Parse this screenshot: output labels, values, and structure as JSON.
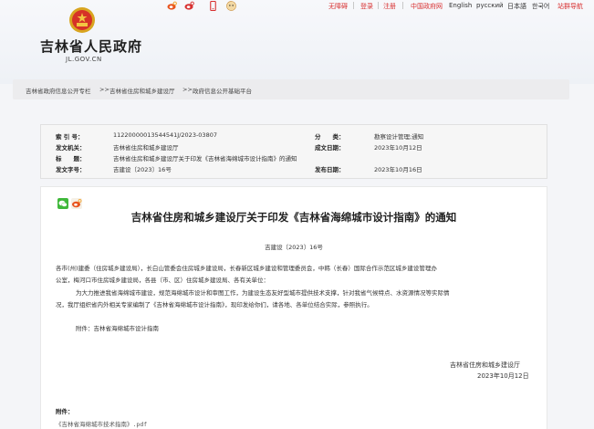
{
  "header": {
    "title": "吉林省人民政府",
    "domain": "JL.GOV.CN"
  },
  "topbar": {
    "icons": [
      "weibo-icon",
      "weibo-icon",
      "mobile-icon",
      "mascot-icon"
    ],
    "links": [
      "无障碍",
      "登录",
      "注册",
      "中国政府网",
      "English",
      "русский",
      "日本語",
      "한국어",
      "站群导航"
    ]
  },
  "breadcrumb": {
    "items": [
      "吉林省政府信息公开专栏",
      ">>",
      "吉林省住房和城乡建设厅",
      ">>",
      "政府信息公开基础平台"
    ]
  },
  "meta": {
    "index_label": "索 引 号：",
    "index_value": "11220000013544541J/2023-03807",
    "category_label": "分　　类：",
    "category_value": "勘察设计管理;通知",
    "issuer_label": "发文机关：",
    "issuer_value": "吉林省住房和城乡建设厅",
    "date_label": "成文日期：",
    "date_value": "2023年10月12日",
    "title_label": "标　　题：",
    "title_value": "吉林省住房和城乡建设厅关于印发《吉林省海绵城市设计指南》的通知",
    "docno_label": "发文字号：",
    "docno_value": "吉建设〔2023〕16号",
    "publish_label": "发布日期：",
    "publish_value": "2023年10月16日"
  },
  "article": {
    "title": "吉林省住房和城乡建设厅关于印发《吉林省海绵城市设计指南》的通知",
    "doc_number": "吉建设〔2023〕16号",
    "p1_line1": "各市(州)建委（住房城乡建设局），长白山管委会住房城乡建设局，长春新区城乡建设和管理委员会，中韩（长春）国际合作示范区城乡建设管理办",
    "p1_line2": "公室，梅河口市住房城乡建设局，各县（市、区）住房城乡建设局、各有关单位：",
    "p2_line1": "为大力推进我省海绵城市建设，规范海绵城市设计和审图工作，为建设生态友好型城市提供技术支撑，针对我省气候特点、水资源情况等实际情",
    "p2_line2": "况，我厅组织省内外相关专家编制了《吉林省海绵城市设计指南》，现印发给你们，请各地、各单位结合实际，参照执行。",
    "attachment_inline": "附件：吉林省海绵城市设计指南",
    "signature": "吉林省住房和城乡建设厅",
    "sign_date": "2023年10月12日",
    "attachments_label": "附件：",
    "attachment_file": "《吉林省海绵城市技术指南》.pdf"
  },
  "colors": {
    "accent": "#d83232",
    "page_bg": "#f4f5f8",
    "meta_bg": "#f6f6f6"
  }
}
